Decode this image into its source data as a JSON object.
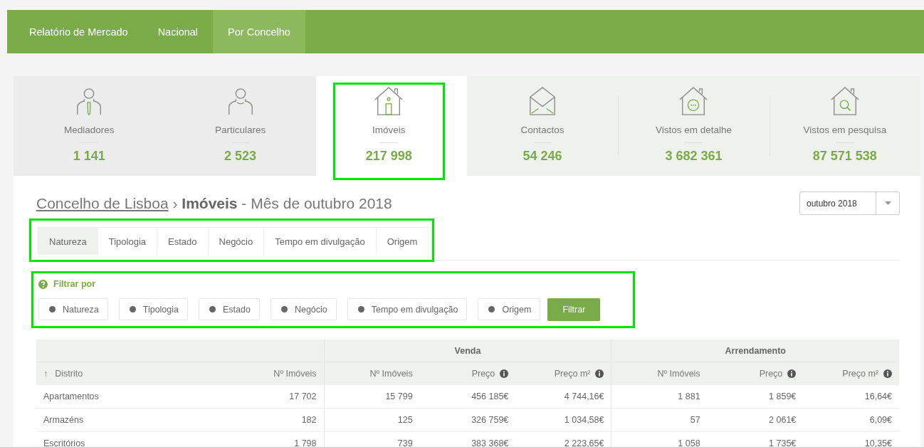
{
  "nav": {
    "items": [
      {
        "label": "Relatório de Mercado",
        "selected": false
      },
      {
        "label": "Nacional",
        "selected": false
      },
      {
        "label": "Por Concelho",
        "selected": true
      }
    ]
  },
  "stats": [
    {
      "label": "Mediadores",
      "value": "1 141",
      "selected": false
    },
    {
      "label": "Particulares",
      "value": "2 523",
      "selected": false
    },
    {
      "label": "Imóveis",
      "value": "217 998",
      "selected": true
    },
    {
      "label": "Contactos",
      "value": "54 246",
      "selected": false
    },
    {
      "label": "Vistos em detalhe",
      "value": "3 682 361",
      "selected": false
    },
    {
      "label": "Vistos em pesquisa",
      "value": "87 571 538",
      "selected": false
    }
  ],
  "heading": {
    "link": "Concelho de Lisboa",
    "separator": "›",
    "subject": "Imóveis",
    "rest": "- Mês de outubro 2018"
  },
  "month_select": {
    "value": "outubro 2018"
  },
  "tabs": [
    {
      "label": "Natureza",
      "selected": true
    },
    {
      "label": "Tipologia",
      "selected": false
    },
    {
      "label": "Estado",
      "selected": false
    },
    {
      "label": "Negócio",
      "selected": false
    },
    {
      "label": "Tempo em divulgação",
      "selected": false
    },
    {
      "label": "Origem",
      "selected": false
    }
  ],
  "filter": {
    "title": "Filtrar por",
    "options": [
      "Natureza",
      "Tipologia",
      "Estado",
      "Negócio",
      "Tempo em divulgação",
      "Origem"
    ],
    "button": "Filtrar"
  },
  "table": {
    "groups": [
      "Venda",
      "Arrendamento"
    ],
    "columns": [
      {
        "label": "Distrito",
        "sort": "↑",
        "info": false
      },
      {
        "label": "Nº Imóveis",
        "info": false
      },
      {
        "label": "Nº Imóveis",
        "info": false
      },
      {
        "label": "Preço",
        "info": true
      },
      {
        "label": "Preço m²",
        "info": true
      },
      {
        "label": "Nº Imóveis",
        "info": false
      },
      {
        "label": "Preço",
        "info": true
      },
      {
        "label": "Preço m²",
        "info": true
      }
    ],
    "rows": [
      [
        "Apartamentos",
        "17 702",
        "15 799",
        "456 185€",
        "4 744,16€",
        "1 881",
        "1 859€",
        "16,64€"
      ],
      [
        "Armazéns",
        "182",
        "125",
        "326 759€",
        "1 034,58€",
        "57",
        "2 061€",
        "6,09€"
      ],
      [
        "Escritórios",
        "1 798",
        "739",
        "383 368€",
        "2 223,65€",
        "1 058",
        "1 735€",
        "10,35€"
      ]
    ]
  }
}
